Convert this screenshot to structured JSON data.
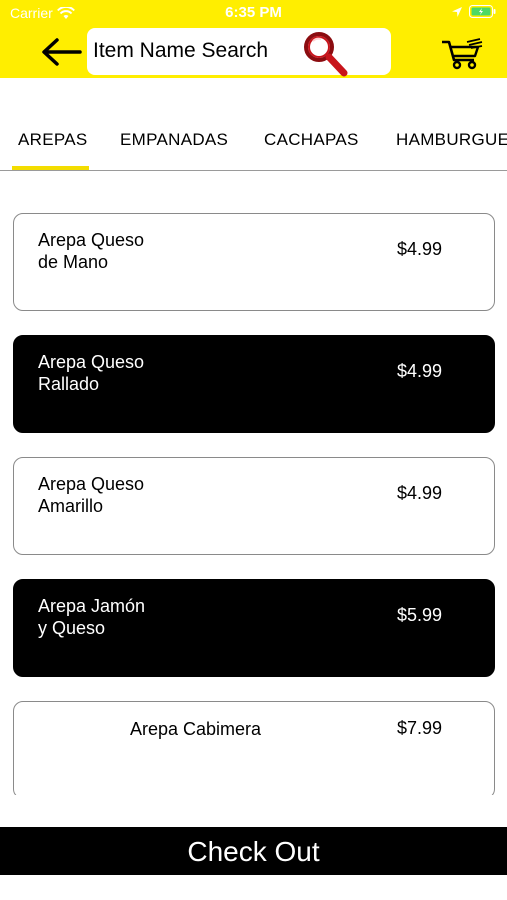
{
  "status_bar": {
    "carrier": "Carrier",
    "time": "6:35 PM"
  },
  "header": {
    "background_color": "#ffee00",
    "back_icon": "arrow-left-icon",
    "search": {
      "placeholder": "Item Name Search",
      "value": ""
    },
    "search_icon": "magnifier-icon",
    "cart_icon": "shopping-cart-icon"
  },
  "tabs": [
    {
      "label": "AREPAS",
      "active": true
    },
    {
      "label": "EMPANADAS",
      "active": false
    },
    {
      "label": "CACHAPAS",
      "active": false
    },
    {
      "label": "HAMBURGUE",
      "active": false
    }
  ],
  "items": [
    {
      "name_line1": "Arepa Queso",
      "name_line2": "de Mano",
      "price": "$4.99",
      "style": "light"
    },
    {
      "name_line1": "Arepa Queso",
      "name_line2": "Rallado",
      "price": "$4.99",
      "style": "dark"
    },
    {
      "name_line1": "Arepa Queso",
      "name_line2": "Amarillo",
      "price": "$4.99",
      "style": "light"
    },
    {
      "name_line1": "Arepa Jamón",
      "name_line2": "y Queso",
      "price": "$5.99",
      "style": "dark"
    },
    {
      "name_line1": "Arepa Cabimera",
      "name_line2": "",
      "price": "$7.99",
      "style": "light"
    }
  ],
  "checkout": {
    "label": "Check Out"
  }
}
